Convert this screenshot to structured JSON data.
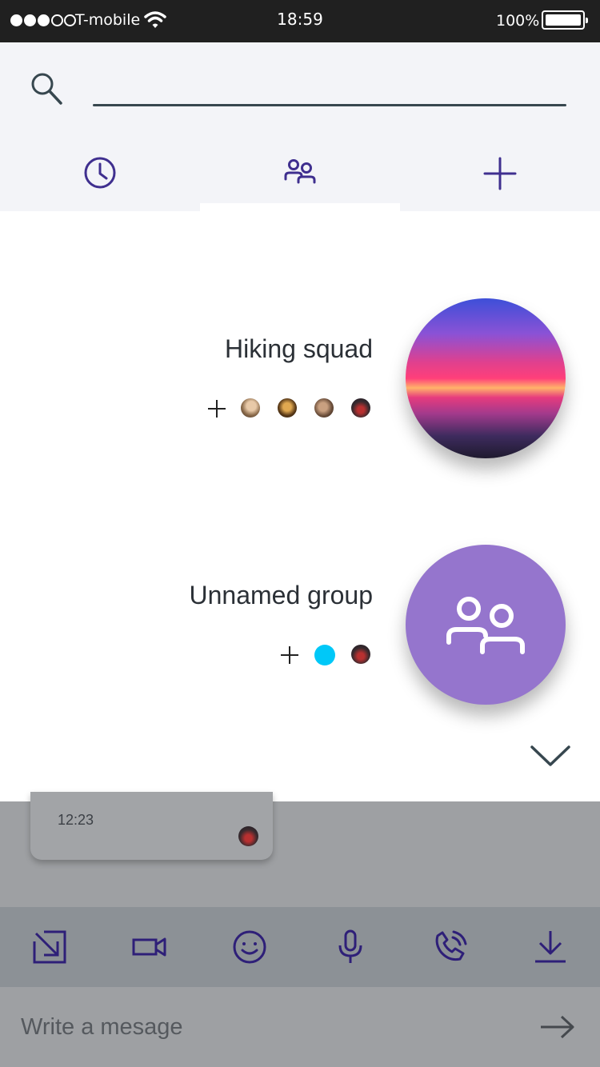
{
  "status_bar": {
    "carrier": "T-mobile",
    "time": "18:59",
    "battery": "100%",
    "signal_bars_filled": 3,
    "signal_bars_total": 5
  },
  "search": {
    "placeholder": "",
    "value": ""
  },
  "tabs": [
    {
      "icon": "clock-icon",
      "active": false
    },
    {
      "icon": "people-icon",
      "active": true
    },
    {
      "icon": "plus-icon",
      "active": false
    }
  ],
  "groups": [
    {
      "name": "Hiking squad",
      "avatar": "sunset-photo",
      "members": [
        "member-1",
        "member-2",
        "member-3",
        "member-4"
      ]
    },
    {
      "name": "Unnamed group",
      "avatar": "people-icon",
      "members": [
        "member-cyan",
        "member-4"
      ]
    }
  ],
  "message_preview": {
    "time": "12:23"
  },
  "toolbar_icons": [
    "expand-arrow-icon",
    "video-camera-icon",
    "smiley-icon",
    "microphone-icon",
    "phone-call-icon",
    "download-icon"
  ],
  "composer": {
    "placeholder": "Write a mesage",
    "value": ""
  },
  "colors": {
    "accent": "#3f2f8f",
    "group_avatar_bg": "#9575cd",
    "cyan_status": "#00c8f8",
    "dim_overlay": "#9ea0a3"
  }
}
